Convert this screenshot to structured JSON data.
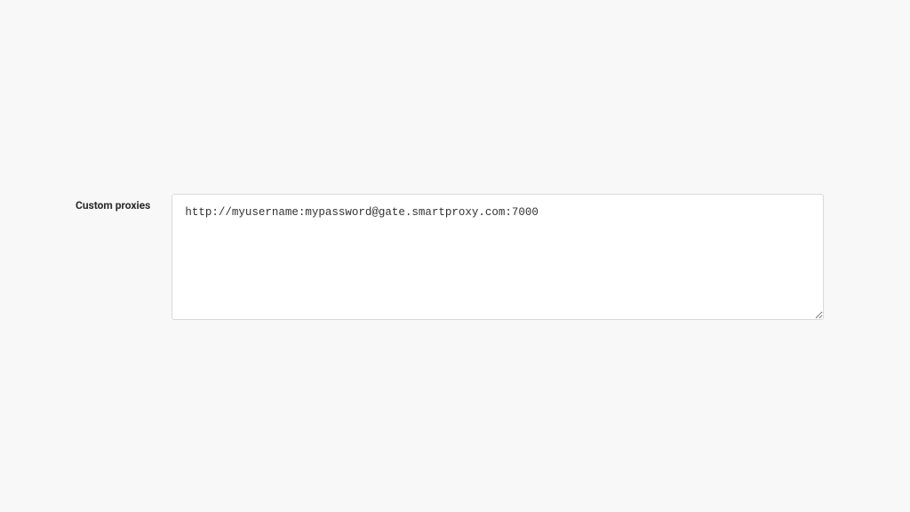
{
  "form": {
    "custom_proxies": {
      "label": "Custom proxies",
      "value": "http://myusername:mypassword@gate.smartproxy.com:7000"
    }
  }
}
